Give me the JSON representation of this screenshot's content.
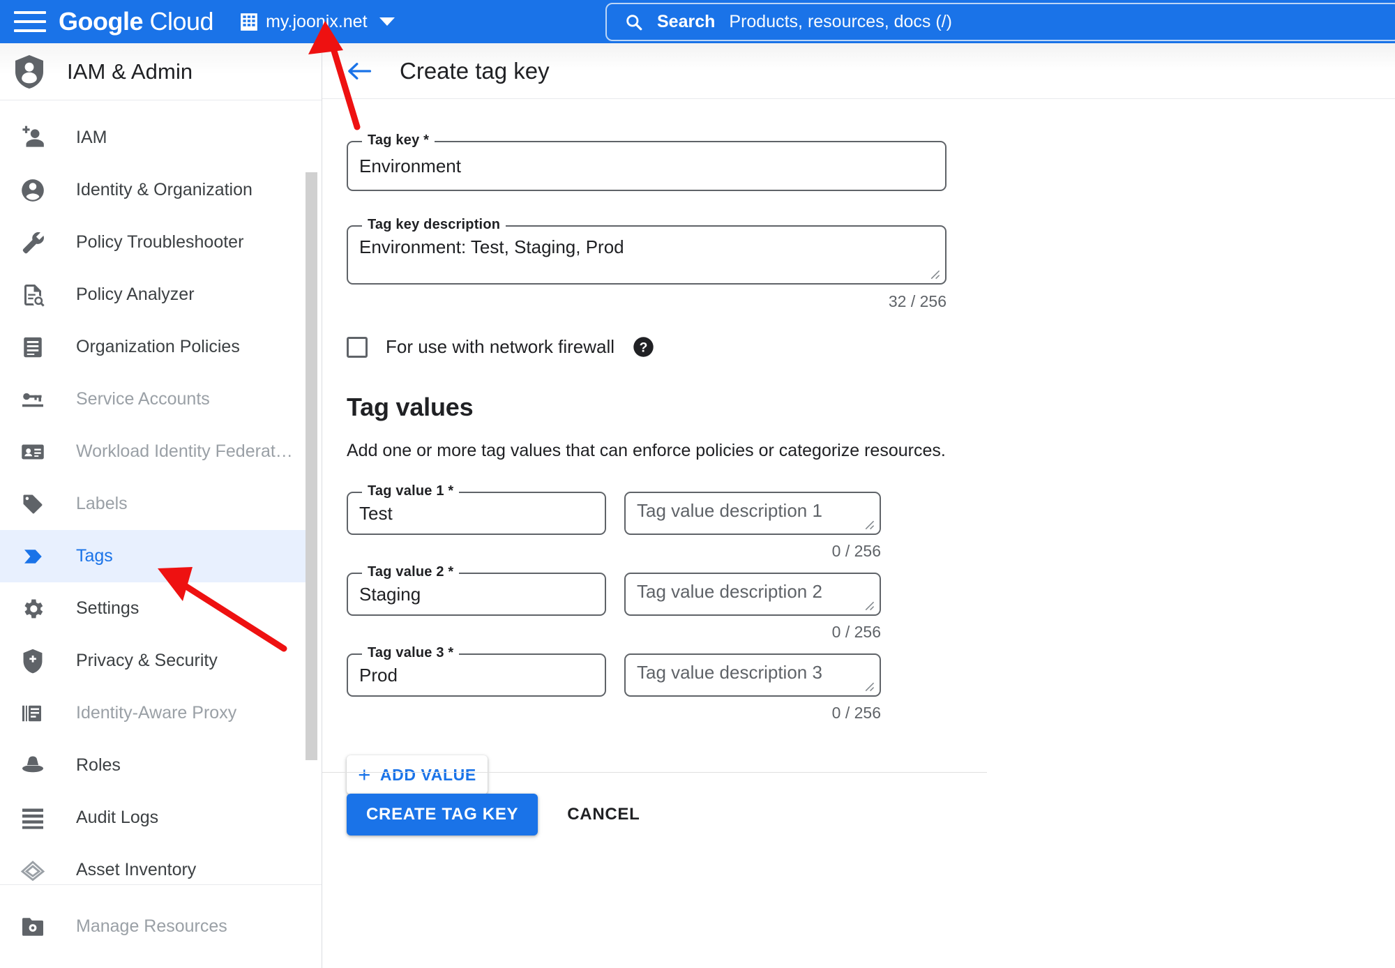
{
  "topbar": {
    "menu_icon": "hamburger-menu-icon",
    "brand_google": "Google",
    "brand_cloud": "Cloud",
    "org_icon": "organization-building-icon",
    "project_name": "my.joonix.net",
    "dropdown_icon": "chevron-down-icon",
    "search_icon": "search-icon",
    "search_label": "Search",
    "search_placeholder": "Products, resources, docs (/)",
    "accent_color": "#1a73e8"
  },
  "sidebar": {
    "title": "IAM & Admin",
    "title_icon": "shield-person-icon",
    "items": [
      {
        "label": "IAM",
        "icon": "person-add-icon",
        "state": "normal"
      },
      {
        "label": "Identity & Organization",
        "icon": "account-circle-icon",
        "state": "normal"
      },
      {
        "label": "Policy Troubleshooter",
        "icon": "wrench-icon",
        "state": "normal"
      },
      {
        "label": "Policy Analyzer",
        "icon": "document-search-icon",
        "state": "normal"
      },
      {
        "label": "Organization Policies",
        "icon": "list-document-icon",
        "state": "normal"
      },
      {
        "label": "Service Accounts",
        "icon": "key-card-icon",
        "state": "dim"
      },
      {
        "label": "Workload Identity Federat…",
        "icon": "id-card-icon",
        "state": "dim"
      },
      {
        "label": "Labels",
        "icon": "label-tag-icon",
        "state": "dim"
      },
      {
        "label": "Tags",
        "icon": "tag-arrow-icon",
        "state": "active"
      },
      {
        "label": "Settings",
        "icon": "gear-icon",
        "state": "normal"
      },
      {
        "label": "Privacy & Security",
        "icon": "shield-icon",
        "state": "normal"
      },
      {
        "label": "Identity-Aware Proxy",
        "icon": "proxy-icon",
        "state": "dim"
      },
      {
        "label": "Roles",
        "icon": "hat-icon",
        "state": "normal"
      },
      {
        "label": "Audit Logs",
        "icon": "lines-icon",
        "state": "normal"
      },
      {
        "label": "Asset Inventory",
        "icon": "asset-icon",
        "state": "normal"
      }
    ],
    "footer_item": {
      "label": "Manage Resources",
      "icon": "folder-gear-icon"
    },
    "active_bg": "#e8f0fe",
    "active_fg": "#1a73e8"
  },
  "main": {
    "back_icon": "back-arrow-icon",
    "page_title": "Create tag key",
    "tag_key": {
      "label": "Tag key *",
      "value": "Environment",
      "selected": true
    },
    "tag_key_description": {
      "label": "Tag key description",
      "value": "Environment: Test, Staging, Prod",
      "counter": "32 / 256"
    },
    "firewall_checkbox": {
      "label": "For use with network firewall",
      "checked": false,
      "help_icon": "help-circle-icon"
    },
    "tag_values_section": {
      "title": "Tag values",
      "description": "Add one or more tag values that can enforce policies or categorize resources.",
      "rows": [
        {
          "key_label": "Tag value 1 *",
          "key_value": "Test",
          "key_selected": false,
          "desc_placeholder": "Tag value description 1",
          "desc_value": "",
          "counter": "0 / 256"
        },
        {
          "key_label": "Tag value 2 *",
          "key_value": "Staging",
          "key_selected": true,
          "desc_placeholder": "Tag value description 2",
          "desc_value": "",
          "counter": "0 / 256"
        },
        {
          "key_label": "Tag value 3 *",
          "key_value": "Prod",
          "key_selected": false,
          "desc_placeholder": "Tag value description 3",
          "desc_value": "",
          "counter": "0 / 256"
        }
      ],
      "add_value_label": "ADD VALUE",
      "add_value_icon": "plus-icon"
    },
    "actions": {
      "primary_label": "CREATE TAG KEY",
      "cancel_label": "CANCEL"
    }
  },
  "annotations": {
    "arrow_color": "#ee1111",
    "arrows": [
      {
        "name": "arrow-to-project-picker"
      },
      {
        "name": "arrow-to-tags-nav-item"
      }
    ]
  }
}
